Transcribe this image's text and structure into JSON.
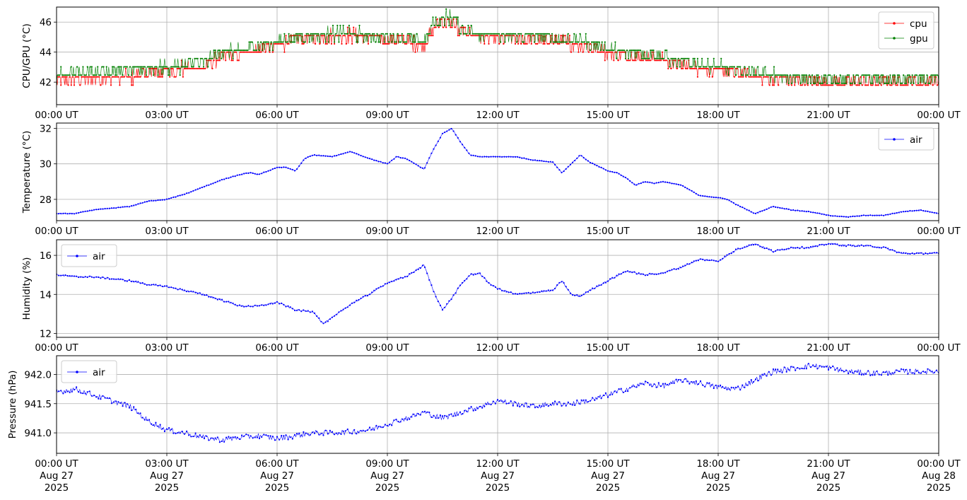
{
  "chart_data": [
    {
      "type": "line",
      "ylabel": "CPU/GPU (°C)",
      "ylim": [
        40.5,
        47.0
      ],
      "yticks": [
        "42",
        "44",
        "46"
      ],
      "ytick_values": [
        42,
        44,
        46
      ],
      "xlim": [
        0,
        24
      ],
      "xticks": [
        "00:00 UT",
        "03:00 UT",
        "06:00 UT",
        "09:00 UT",
        "12:00 UT",
        "15:00 UT",
        "18:00 UT",
        "21:00 UT",
        "00:00 UT"
      ],
      "grid": true,
      "legend": "top-right",
      "series": [
        {
          "name": "cpu",
          "color": "#ff0000",
          "x": [
            0,
            0.5,
            1,
            1.5,
            2,
            2.5,
            3,
            3.5,
            4,
            4.5,
            5,
            5.5,
            6,
            6.5,
            7,
            7.5,
            8,
            8.5,
            9,
            9.5,
            10,
            10.25,
            10.5,
            10.75,
            11,
            11.5,
            12,
            12.5,
            13,
            13.5,
            14,
            14.5,
            15,
            15.5,
            16,
            16.5,
            17,
            17.5,
            18,
            18.5,
            19,
            19.5,
            20,
            20.5,
            21,
            21.5,
            22,
            22.5,
            23,
            23.5,
            24
          ],
          "values": [
            42.0,
            42.2,
            42.2,
            42.3,
            42.3,
            42.6,
            42.8,
            42.9,
            43.0,
            43.7,
            43.9,
            44.2,
            44.4,
            44.8,
            45.0,
            45.1,
            45.1,
            45.0,
            44.9,
            44.7,
            44.4,
            45.6,
            46.0,
            46.1,
            45.3,
            45.0,
            44.9,
            44.9,
            44.8,
            44.7,
            44.6,
            44.4,
            44.0,
            43.7,
            43.7,
            43.5,
            43.1,
            42.9,
            42.8,
            42.6,
            42.4,
            42.2,
            42.1,
            42.0,
            42.0,
            41.9,
            42.0,
            42.0,
            42.0,
            42.0,
            42.0
          ]
        },
        {
          "name": "gpu",
          "color": "#008000",
          "x": [
            0,
            0.5,
            1,
            1.5,
            2,
            2.5,
            3,
            3.5,
            4,
            4.5,
            5,
            5.5,
            6,
            6.5,
            7,
            7.5,
            8,
            8.5,
            9,
            9.5,
            10,
            10.25,
            10.5,
            10.75,
            11,
            11.5,
            12,
            12.5,
            13,
            13.5,
            14,
            14.5,
            15,
            15.5,
            16,
            16.5,
            17,
            17.5,
            18,
            18.5,
            19,
            19.5,
            20,
            20.5,
            21,
            21.5,
            22,
            22.5,
            23,
            23.5,
            24
          ],
          "values": [
            42.3,
            42.5,
            42.5,
            42.7,
            42.7,
            42.8,
            42.9,
            43.0,
            43.2,
            43.9,
            44.0,
            44.3,
            44.6,
            44.9,
            45.0,
            45.1,
            45.1,
            45.0,
            45.0,
            44.8,
            44.6,
            45.7,
            46.2,
            46.2,
            45.4,
            45.1,
            45.0,
            44.9,
            44.9,
            44.8,
            44.7,
            44.5,
            44.1,
            43.8,
            43.9,
            43.6,
            43.2,
            43.0,
            42.9,
            42.7,
            42.5,
            42.3,
            42.2,
            42.1,
            42.1,
            42.0,
            42.1,
            42.1,
            42.0,
            42.1,
            42.1
          ]
        }
      ]
    },
    {
      "type": "line",
      "ylabel": "Temperature (°C)",
      "ylim": [
        26.8,
        32.3
      ],
      "yticks": [
        "28",
        "30",
        "32"
      ],
      "ytick_values": [
        28,
        30,
        32
      ],
      "xlim": [
        0,
        24
      ],
      "xticks": [
        "00:00 UT",
        "03:00 UT",
        "06:00 UT",
        "09:00 UT",
        "12:00 UT",
        "15:00 UT",
        "18:00 UT",
        "21:00 UT",
        "00:00 UT"
      ],
      "grid": true,
      "legend": "top-right",
      "series": [
        {
          "name": "air",
          "color": "#0000ff",
          "x": [
            0,
            0.5,
            1,
            1.5,
            2,
            2.5,
            3,
            3.5,
            4,
            4.5,
            5,
            5.25,
            5.5,
            6,
            6.25,
            6.5,
            6.75,
            7,
            7.5,
            8,
            8.5,
            9,
            9.25,
            9.5,
            10,
            10.25,
            10.5,
            10.75,
            11,
            11.25,
            11.5,
            12,
            12.5,
            13,
            13.5,
            13.75,
            14,
            14.25,
            14.5,
            15,
            15.25,
            15.5,
            15.75,
            16,
            16.25,
            16.5,
            17,
            17.5,
            18,
            18.25,
            18.5,
            19,
            19.5,
            20,
            20.5,
            21,
            21.5,
            22,
            22.5,
            23,
            23.5,
            24
          ],
          "values": [
            27.2,
            27.2,
            27.4,
            27.5,
            27.6,
            27.9,
            28.0,
            28.3,
            28.7,
            29.1,
            29.4,
            29.5,
            29.4,
            29.8,
            29.8,
            29.6,
            30.3,
            30.5,
            30.4,
            30.7,
            30.3,
            30.0,
            30.4,
            30.3,
            29.7,
            30.8,
            31.7,
            32.0,
            31.2,
            30.5,
            30.4,
            30.4,
            30.4,
            30.2,
            30.1,
            29.5,
            30.0,
            30.5,
            30.1,
            29.6,
            29.5,
            29.2,
            28.8,
            29.0,
            28.9,
            29.0,
            28.8,
            28.2,
            28.1,
            28.0,
            27.7,
            27.2,
            27.6,
            27.4,
            27.3,
            27.1,
            27.0,
            27.1,
            27.1,
            27.3,
            27.4,
            27.2
          ]
        }
      ]
    },
    {
      "type": "line",
      "ylabel": "Humidity (%)",
      "ylim": [
        11.8,
        16.8
      ],
      "yticks": [
        "12",
        "14",
        "16"
      ],
      "ytick_values": [
        12,
        14,
        16
      ],
      "xlim": [
        0,
        24
      ],
      "xticks": [
        "00:00 UT",
        "03:00 UT",
        "06:00 UT",
        "09:00 UT",
        "12:00 UT",
        "15:00 UT",
        "18:00 UT",
        "21:00 UT",
        "00:00 UT"
      ],
      "grid": true,
      "legend": "top-left",
      "series": [
        {
          "name": "air",
          "color": "#0000ff",
          "x": [
            0,
            0.5,
            1,
            1.5,
            2,
            2.5,
            3,
            3.5,
            4,
            4.5,
            5,
            5.5,
            6,
            6.5,
            7,
            7.25,
            7.5,
            8,
            8.5,
            9,
            9.5,
            10,
            10.25,
            10.5,
            10.75,
            11,
            11.25,
            11.5,
            11.75,
            12,
            12.5,
            13,
            13.5,
            13.75,
            14,
            14.25,
            14.5,
            15,
            15.5,
            16,
            16.5,
            17,
            17.5,
            18,
            18.5,
            19,
            19.5,
            20,
            20.5,
            21,
            21.5,
            22,
            22.5,
            23,
            23.5,
            24
          ],
          "values": [
            15.0,
            14.9,
            14.9,
            14.8,
            14.7,
            14.5,
            14.4,
            14.2,
            14.0,
            13.7,
            13.4,
            13.4,
            13.6,
            13.2,
            13.1,
            12.5,
            12.8,
            13.5,
            14.0,
            14.6,
            14.9,
            15.5,
            14.2,
            13.2,
            13.8,
            14.5,
            15.0,
            15.1,
            14.6,
            14.3,
            14.0,
            14.1,
            14.2,
            14.7,
            14.0,
            13.9,
            14.2,
            14.7,
            15.2,
            15.0,
            15.1,
            15.4,
            15.8,
            15.7,
            16.3,
            16.6,
            16.2,
            16.4,
            16.4,
            16.6,
            16.5,
            16.5,
            16.4,
            16.1,
            16.1,
            16.1
          ]
        }
      ]
    },
    {
      "type": "line",
      "ylabel": "Pressure (hPa)",
      "ylim": [
        940.65,
        942.32
      ],
      "yticks": [
        "941.0",
        "941.5",
        "942.0"
      ],
      "ytick_values": [
        941.0,
        941.5,
        942.0
      ],
      "xlim": [
        0,
        24
      ],
      "xticks": [
        "00:00 UT\nAug 27\n2025",
        "03:00 UT\nAug 27\n2025",
        "06:00 UT\nAug 27\n2025",
        "09:00 UT\nAug 27\n2025",
        "12:00 UT\nAug 27\n2025",
        "15:00 UT\nAug 27\n2025",
        "18:00 UT\nAug 27\n2025",
        "21:00 UT\nAug 27\n2025",
        "00:00 UT\nAug 28\n2025"
      ],
      "grid": true,
      "legend": "top-left",
      "series": [
        {
          "name": "air",
          "color": "#0000ff",
          "x": [
            0,
            0.5,
            1,
            1.5,
            2,
            2.5,
            3,
            3.5,
            4,
            4.5,
            5,
            5.5,
            6,
            6.5,
            7,
            7.5,
            8,
            8.5,
            9,
            9.5,
            10,
            10.5,
            11,
            11.5,
            12,
            12.5,
            13,
            13.5,
            14,
            14.5,
            15,
            15.5,
            16,
            16.5,
            17,
            17.5,
            18,
            18.5,
            19,
            19.5,
            20,
            20.5,
            21,
            21.5,
            22,
            22.5,
            23,
            23.5,
            24
          ],
          "values": [
            941.7,
            941.75,
            941.65,
            941.55,
            941.45,
            941.2,
            941.05,
            941.0,
            940.92,
            940.88,
            940.92,
            940.95,
            940.9,
            940.95,
            941.0,
            941.0,
            941.02,
            941.05,
            941.15,
            941.25,
            941.35,
            941.25,
            941.35,
            941.45,
            941.55,
            941.5,
            941.45,
            941.5,
            941.5,
            941.55,
            941.65,
            941.75,
            941.85,
            941.8,
            941.9,
            941.85,
            941.78,
            941.75,
            941.9,
            942.05,
            942.1,
            942.15,
            942.12,
            942.05,
            942.03,
            942.02,
            942.05,
            942.05,
            942.05
          ]
        }
      ]
    }
  ]
}
